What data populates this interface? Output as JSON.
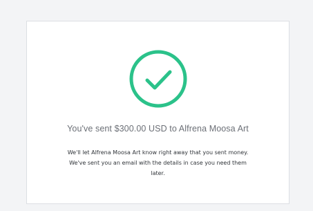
{
  "confirmation": {
    "icon": "checkmark-circle-icon",
    "accent_color": "#2bc28a",
    "headline": "You've sent $300.00 USD to Alfrena Moosa Art",
    "message": "We'll let Alfrena Moosa Art know right away that you sent money. We've sent you an email with the details in case you need them later."
  }
}
